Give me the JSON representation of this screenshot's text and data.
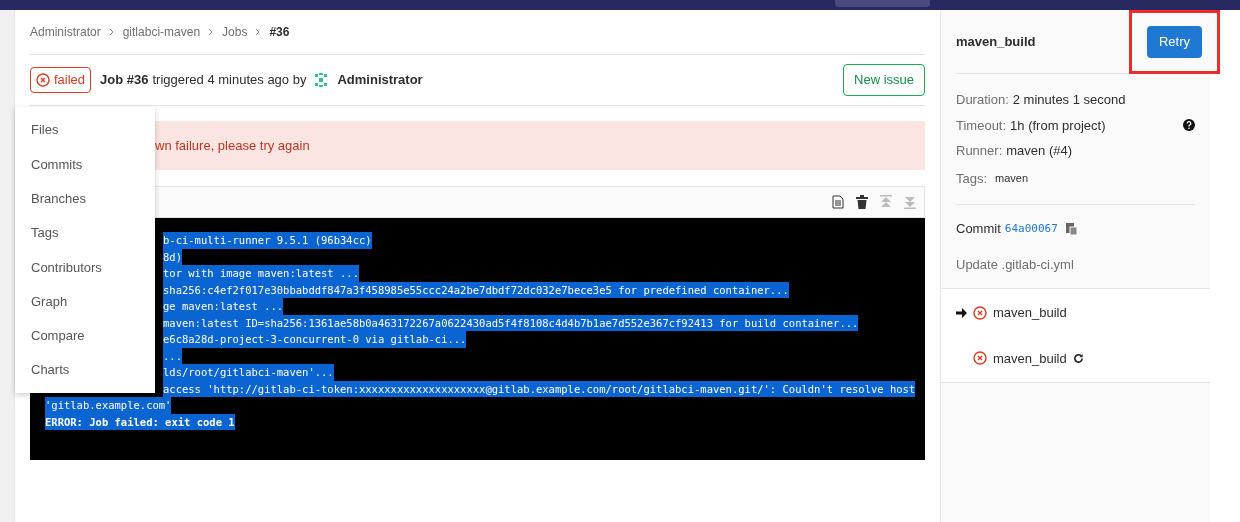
{
  "breadcrumb": [
    {
      "label": "Administrator",
      "current": false
    },
    {
      "label": "gitlabci-maven",
      "current": false
    },
    {
      "label": "Jobs",
      "current": false
    },
    {
      "label": "#36",
      "current": true
    }
  ],
  "job_header": {
    "status": "failed",
    "job": "Job #36",
    "triggered": "triggered 4 minutes ago by",
    "user": "Administrator",
    "new_issue_button": "New issue"
  },
  "alert": {
    "text": "wn failure, please try again"
  },
  "dropdown_menu": [
    "Files",
    "Commits",
    "Branches",
    "Tags",
    "Contributors",
    "Graph",
    "Compare",
    "Charts"
  ],
  "log": [
    {
      "text": "b-ci-multi-runner 9.5.1 (96b34cc)",
      "partial": true,
      "bold": false
    },
    {
      "text": "8d)",
      "partial": true,
      "bold": false
    },
    {
      "text": "tor with image maven:latest ...",
      "partial": true,
      "bold": false
    },
    {
      "text": "sha256:c4ef2f017e30bbabddf847a3f458985e55ccc24a2be7dbdf72dc032e7bece3e5 for predefined container...",
      "partial": true,
      "bold": false
    },
    {
      "text": "ge maven:latest ...",
      "partial": true,
      "bold": false
    },
    {
      "text": "maven:latest ID=sha256:1361ae58b0a463172267a0622430ad5f4f8108c4d4b7b1ae7d552e367cf92413 for build container...",
      "partial": true,
      "bold": false
    },
    {
      "text": "e6c8a28d-project-3-concurrent-0 via gitlab-ci...",
      "partial": true,
      "bold": false
    },
    {
      "text": "...",
      "partial": true,
      "bold": false
    },
    {
      "text": "lds/root/gitlabci-maven'...",
      "partial": true,
      "bold": false
    },
    {
      "text": "access 'http://gitlab-ci-token:xxxxxxxxxxxxxxxxxxxx@gitlab.example.com/root/gitlabci-maven.git/': Couldn't resolve host",
      "partial": true,
      "bold": false
    },
    {
      "text": "'gitlab.example.com'",
      "partial": false,
      "bold": false
    },
    {
      "text": "ERROR: Job failed: exit code 1",
      "partial": false,
      "bold": true
    }
  ],
  "sidebar": {
    "title": "maven_build",
    "retry_button": "Retry",
    "details": [
      {
        "label": "Duration:",
        "value": "2 minutes 1 second",
        "help": false
      },
      {
        "label": "Timeout:",
        "value": "1h (from project)",
        "help": true
      },
      {
        "label": "Runner:",
        "value": "maven (#4)",
        "help": false
      }
    ],
    "tags_label": "Tags:",
    "tags": [
      "maven"
    ],
    "commit_label": "Commit",
    "commit_sha": "64a00067",
    "commit_message": "Update .gitlab-ci.yml",
    "jobs": [
      {
        "name": "maven_build",
        "current": true,
        "retried": false
      },
      {
        "name": "maven_build",
        "current": false,
        "retried": true
      }
    ]
  }
}
